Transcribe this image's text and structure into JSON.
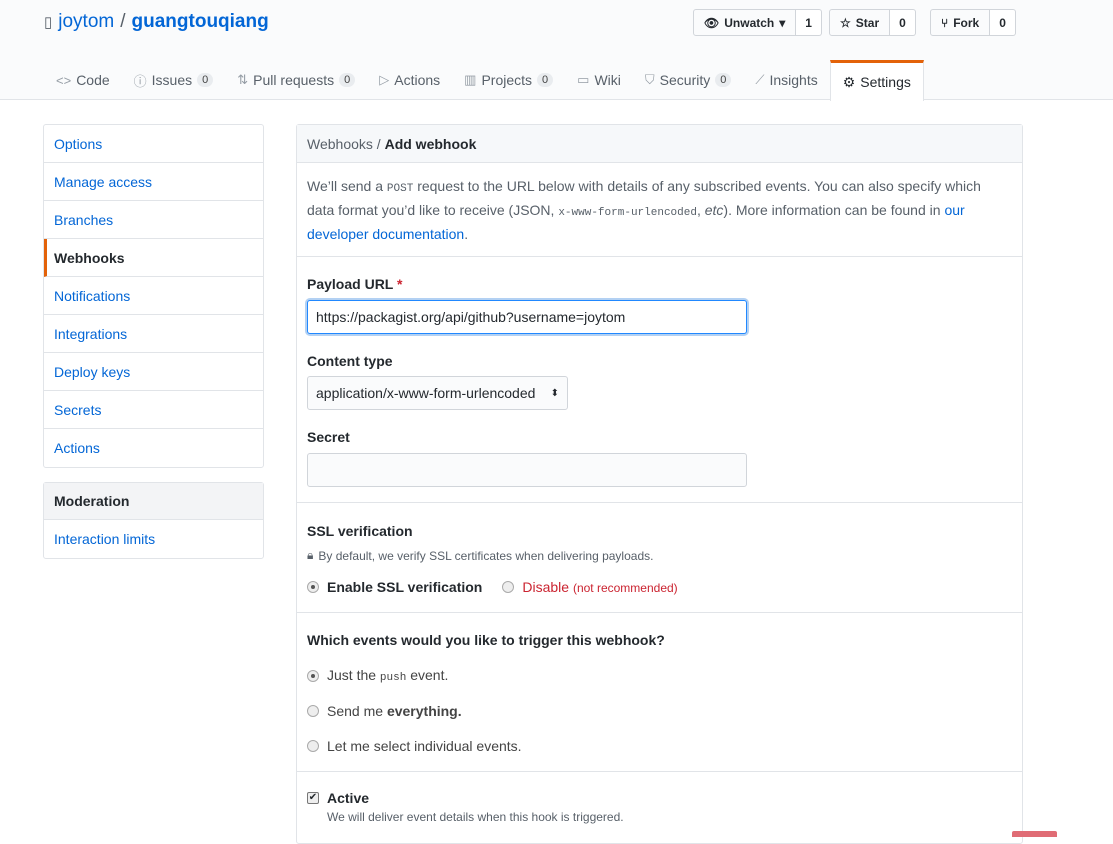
{
  "repo": {
    "owner": "joytom",
    "separator": "/",
    "name": "guangtouqiang"
  },
  "actions": {
    "watch": {
      "label": "Unwatch",
      "count": "1"
    },
    "star": {
      "label": "Star",
      "count": "0"
    },
    "fork": {
      "label": "Fork",
      "count": "0"
    }
  },
  "tabs": [
    {
      "label": "Code",
      "icon": "code-icon"
    },
    {
      "label": "Issues",
      "count": "0",
      "icon": "issue-icon"
    },
    {
      "label": "Pull requests",
      "count": "0",
      "icon": "pr-icon"
    },
    {
      "label": "Actions",
      "icon": "play-icon"
    },
    {
      "label": "Projects",
      "count": "0",
      "icon": "project-icon"
    },
    {
      "label": "Wiki",
      "icon": "book-icon"
    },
    {
      "label": "Security",
      "count": "0",
      "icon": "shield-icon"
    },
    {
      "label": "Insights",
      "icon": "graph-icon"
    },
    {
      "label": "Settings",
      "icon": "gear-icon",
      "selected": true
    }
  ],
  "sidebar": {
    "items": [
      "Options",
      "Manage access",
      "Branches",
      "Webhooks",
      "Notifications",
      "Integrations",
      "Deploy keys",
      "Secrets",
      "Actions"
    ],
    "selected": "Webhooks",
    "moderation": {
      "header": "Moderation",
      "items": [
        "Interaction limits"
      ]
    }
  },
  "main": {
    "breadcrumb": {
      "parent": "Webhooks",
      "sep": " / ",
      "current": "Add webhook"
    },
    "desc": {
      "p1": "We’ll send a ",
      "code1": "POST",
      "p2": " request to the URL below with details of any subscribed events. You can also specify which data format you’d like to receive (JSON, ",
      "code2": "x-www-form-urlencoded",
      "p3": ", ",
      "em": "etc",
      "p4": "). More information can be found in ",
      "link": "our developer documentation",
      "p5": "."
    },
    "payload": {
      "label": "Payload URL",
      "required": "*",
      "value": "https://packagist.org/api/github?username=joytom"
    },
    "content_type": {
      "label": "Content type",
      "value": "application/x-www-form-urlencoded"
    },
    "secret": {
      "label": "Secret",
      "value": ""
    },
    "ssl": {
      "label": "SSL verification",
      "note": "By default, we verify SSL certificates when delivering payloads.",
      "enable": "Enable SSL verification",
      "disable": "Disable",
      "disable_note": "(not recommended)",
      "selected": "enable"
    },
    "events": {
      "label": "Which events would you like to trigger this webhook?",
      "opt1_a": "Just the ",
      "opt1_code": "push",
      "opt1_b": " event.",
      "opt2_a": "Send me ",
      "opt2_b": "everything.",
      "opt3": "Let me select individual events.",
      "selected": "push"
    },
    "active": {
      "label": "Active",
      "note": "We will deliver event details when this hook is triggered.",
      "checked": true
    }
  },
  "colors": {
    "link": "#0366d6",
    "accent": "#e36209",
    "danger": "#cb2431"
  }
}
